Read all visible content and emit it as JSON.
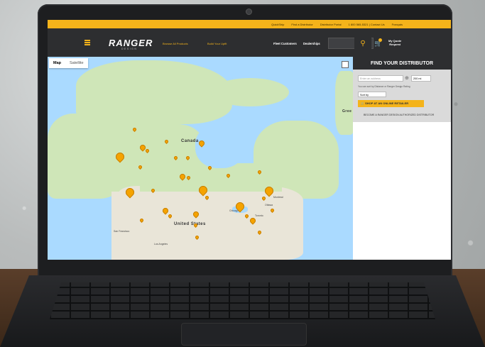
{
  "topbar": {
    "quickship": "QuickShip",
    "find_distributor": "Find a Distributor",
    "distributor_portal": "Distributor Portal",
    "phone_contact": "1 800 565-5321 | Contact Us",
    "language": "Français"
  },
  "nav": {
    "logo": "RANGER",
    "logo_sub": "DESIGN",
    "browse": "Browse All Products",
    "build": "Build Your Upfit",
    "fleet": "Fleet Customers",
    "dealerships": "Dealerships",
    "quote_line1": "My Quote",
    "quote_line2": "Request"
  },
  "map": {
    "tabs": [
      "Map",
      "Satellite"
    ],
    "label_canada": "Canada",
    "label_us": "United States",
    "label_green": "Gree",
    "cities": [
      "San Francisco",
      "Los Angeles",
      "Chicago",
      "Montreal",
      "Toronto",
      "Ottawa"
    ]
  },
  "panel": {
    "title": "FIND YOUR DISTRIBUTOR",
    "address_placeholder": "Enter an address",
    "miles": "200 mi",
    "hint": "You can sort by Distance or Ranger Design Rating",
    "sort": "Sort by",
    "shop_button": "SHOP AT AN ONLINE RETAILER",
    "become": "BECOME A RANGER DESIGN AUTHORIZED DISTRIBUTOR"
  },
  "colors": {
    "accent": "#f4b31a",
    "nav_bg": "#2d2e30",
    "water": "#aadaff"
  }
}
